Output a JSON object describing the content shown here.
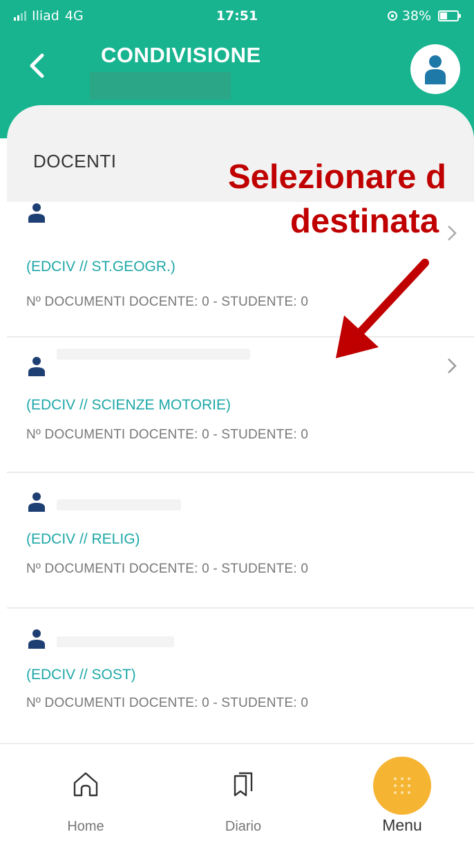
{
  "status_bar": {
    "carrier": "Iliad",
    "network": "4G",
    "time": "17:51",
    "battery": "38%"
  },
  "header": {
    "title": "CONDIVISIONE",
    "back_icon": "chevron-left-icon",
    "avatar_icon": "user-circle-icon"
  },
  "section": {
    "title": "DOCENTI"
  },
  "teachers": [
    {
      "subject": "(EDCIV // ST.GEOGR.)",
      "docs": "Nº DOCUMENTI DOCENTE: 0 - STUDENTE: 0"
    },
    {
      "subject": "(EDCIV // SCIENZE MOTORIE)",
      "docs": "Nº DOCUMENTI DOCENTE: 0 - STUDENTE: 0"
    },
    {
      "subject": "(EDCIV // RELIG)",
      "docs": "Nº DOCUMENTI DOCENTE: 0 - STUDENTE: 0"
    },
    {
      "subject": "(EDCIV // SOST)",
      "docs": "Nº DOCUMENTI DOCENTE: 0 - STUDENTE: 0"
    }
  ],
  "annotation": {
    "line1": "Selezionare d",
    "line2": "destinata",
    "color": "#c00000"
  },
  "bottom_nav": {
    "home": "Home",
    "diario": "Diario",
    "menu": "Menu"
  },
  "colors": {
    "header": "#17b48f",
    "subject_text": "#1ea7a7",
    "menu_accent": "#f6b433"
  }
}
